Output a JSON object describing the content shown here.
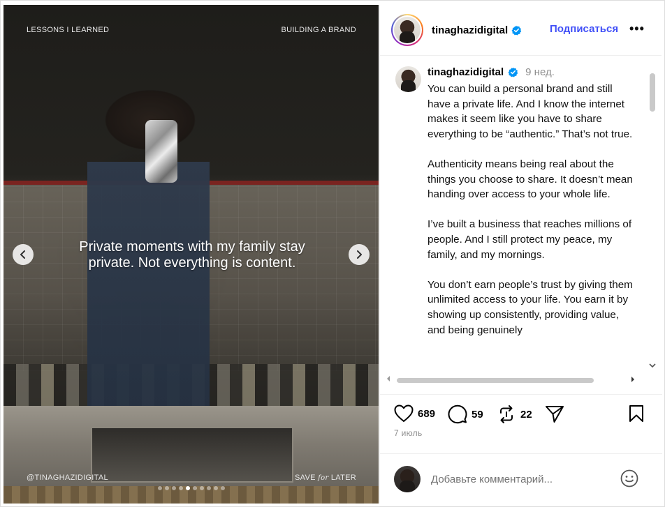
{
  "media": {
    "corner_top_left": "LESSONS I LEARNED",
    "corner_top_right": "BUILDING A BRAND",
    "corner_bottom_left": "@TINAGHAZIDIGITAL",
    "corner_bottom_right_a": "SAVE",
    "corner_bottom_right_script": "for",
    "corner_bottom_right_b": "LATER",
    "caption_line1": "Private moments with my family stay",
    "caption_line2": "private. Not everything is content.",
    "carousel": {
      "total": 10,
      "active_index": 4
    }
  },
  "header": {
    "username": "tinaghazidigital",
    "follow_label": "Подписаться",
    "more_label": "•••"
  },
  "post": {
    "username": "tinaghazidigital",
    "time": "9 нед.",
    "paragraphs": [
      "You can build a personal brand and still have a private life. And I know the internet makes it seem like you have to share everything to be “authentic.” That’s not true.",
      "Authenticity means being real about the things you choose to share. It doesn’t mean handing over access to your whole life.",
      "I’ve built a business that reaches millions of people. And I still protect my peace, my family, and my mornings.",
      "You don’t earn people’s trust by giving them unlimited access to your life. You earn it by showing up consistently, providing value, and being genuinely"
    ]
  },
  "actions": {
    "likes": "689",
    "comments": "59",
    "reposts": "22"
  },
  "date": "7 июль",
  "comment_input": {
    "placeholder": "Добавьте комментарий..."
  },
  "colors": {
    "link_blue": "#4150f7",
    "verified_blue": "#0095f6",
    "muted": "#8e8e8e"
  },
  "icons": [
    "chevron-left-icon",
    "chevron-right-icon",
    "heart-icon",
    "comment-icon",
    "repost-icon",
    "share-icon",
    "bookmark-icon",
    "emoji-icon",
    "verified-badge-icon",
    "more-icon"
  ]
}
